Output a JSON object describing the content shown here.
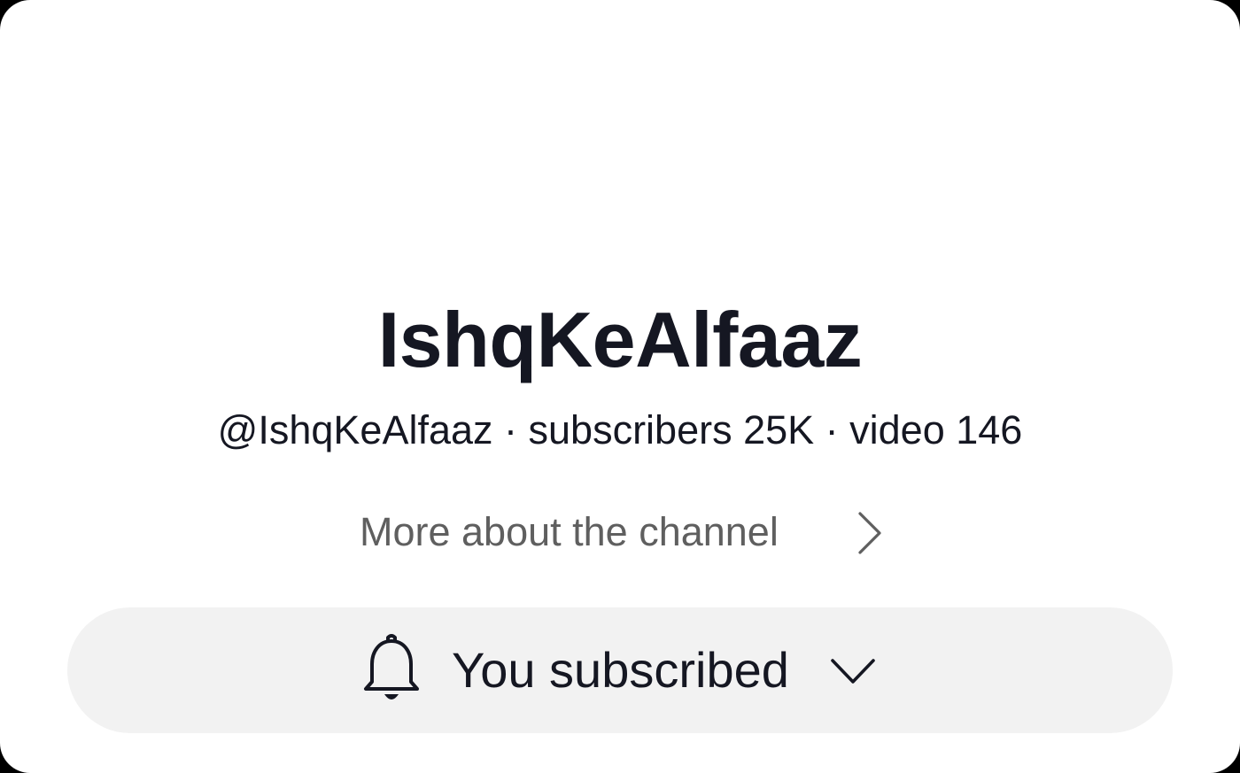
{
  "channel": {
    "name": "IshqKeAlfaaz",
    "meta_line": "@IshqKeAlfaaz · subscribers 25K · video 146",
    "handle": "@IshqKeAlfaaz",
    "subscribers": "25K",
    "videos": "146"
  },
  "more_link": {
    "label": "More about the channel",
    "icon": "chevron-right-icon"
  },
  "subscribe_button": {
    "label": "You subscribed",
    "leading_icon": "bell-icon",
    "trailing_icon": "chevron-down-icon",
    "background": "#f2f2f2"
  },
  "colors": {
    "text_primary": "#151722",
    "text_secondary": "#5f5f5f",
    "card_background": "#ffffff"
  }
}
